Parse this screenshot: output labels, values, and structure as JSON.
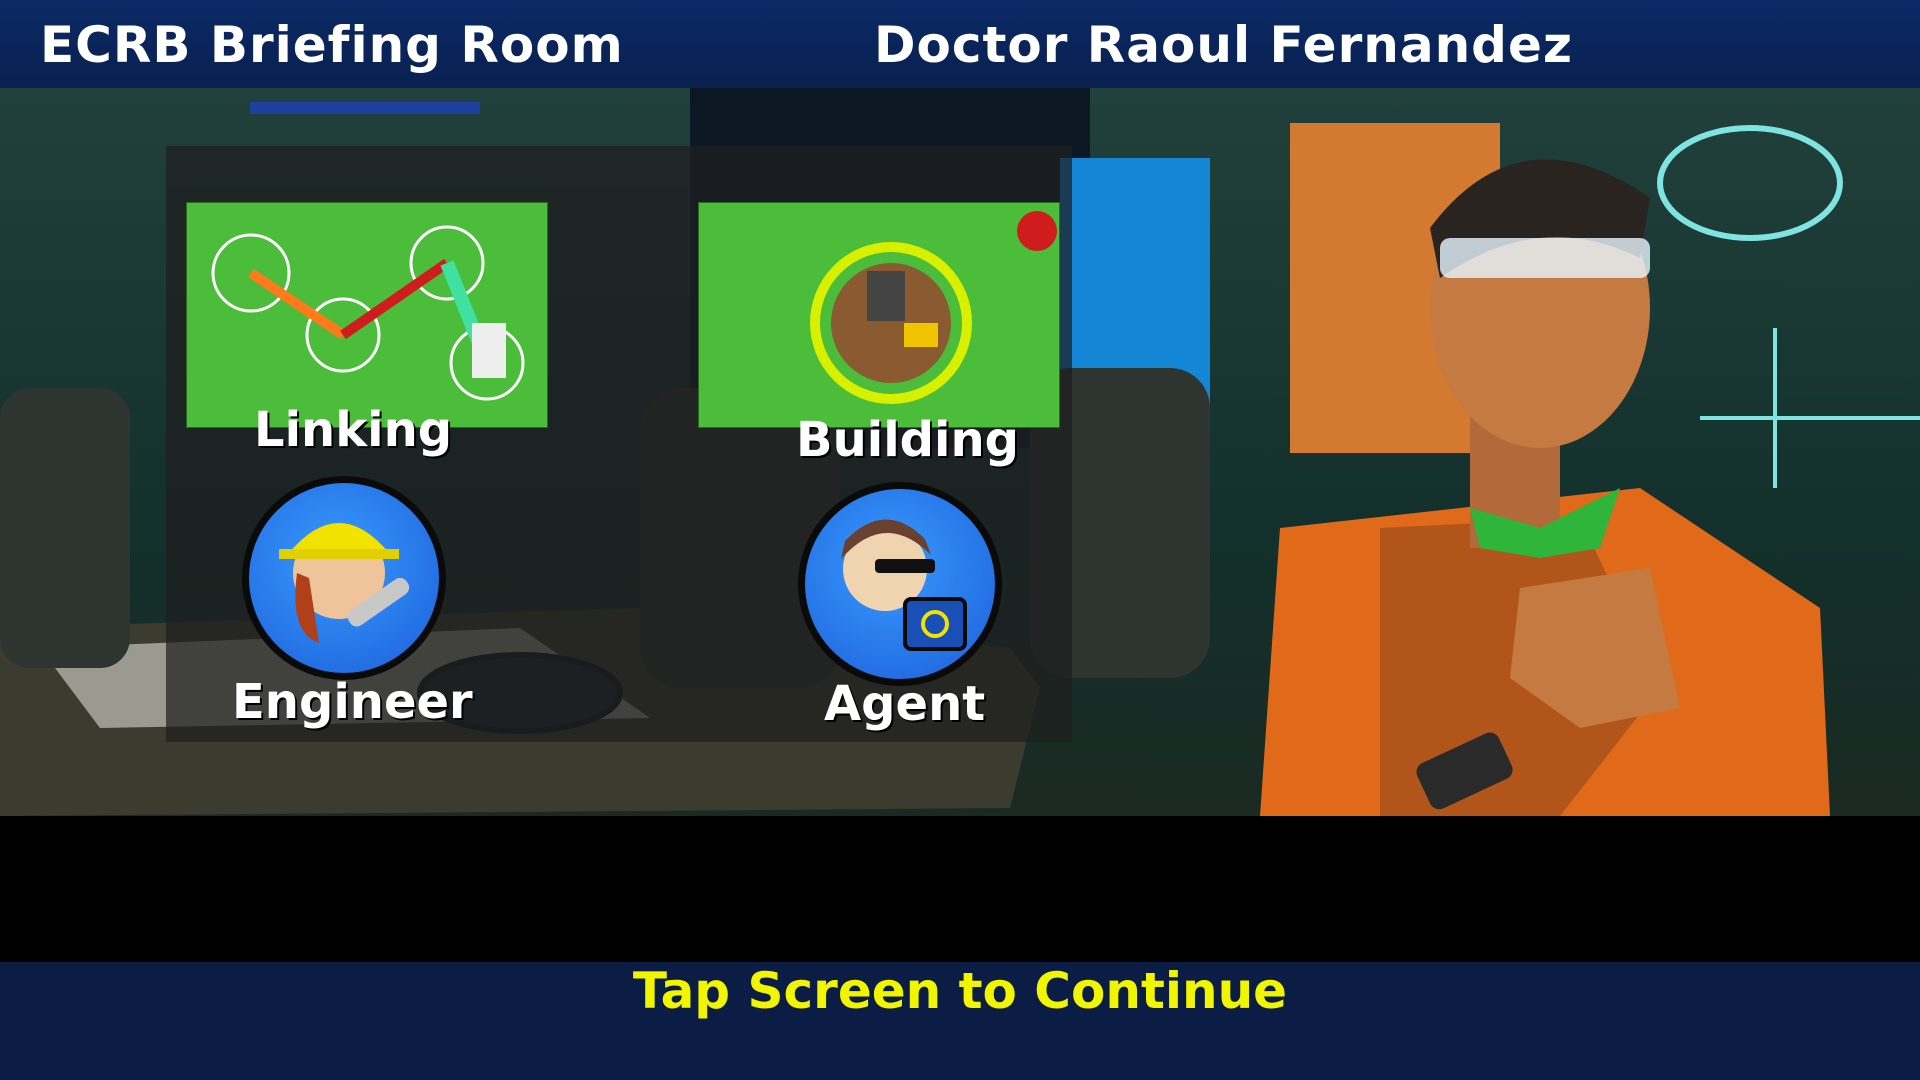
{
  "header": {
    "room_title": "ECRB Briefing Room",
    "speaker_name": "Doctor Raoul Fernandez"
  },
  "cards": [
    {
      "label": "Linking"
    },
    {
      "label": "Building"
    },
    {
      "label": "Engineer"
    },
    {
      "label": "Agent"
    }
  ],
  "footer": {
    "prompt": "Tap Screen to Continue"
  }
}
